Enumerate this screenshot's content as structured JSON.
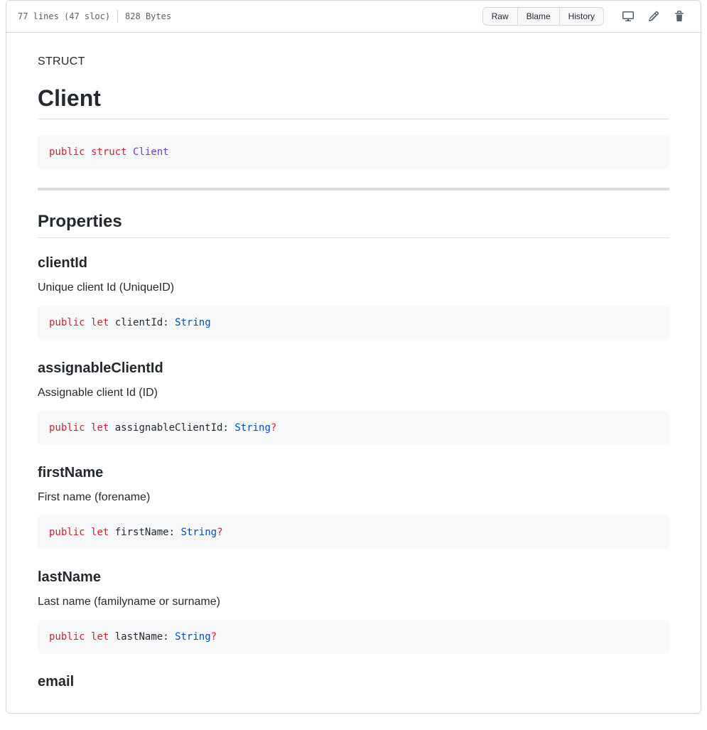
{
  "header": {
    "lines_sloc": "77 lines (47 sloc)",
    "size": "828 Bytes",
    "buttons": {
      "raw": "Raw",
      "blame": "Blame",
      "history": "History"
    }
  },
  "doc": {
    "kicker": "STRUCT",
    "title": "Client",
    "declaration": {
      "keyword1": "public",
      "keyword2": "struct",
      "typename": "Client"
    },
    "sectionTitle": "Properties",
    "properties": [
      {
        "name": "clientId",
        "desc": "Unique client Id (UniqueID)",
        "kw1": "public",
        "kw2": "let",
        "ident": "clientId",
        "colon": ":",
        "type": "String",
        "optional": ""
      },
      {
        "name": "assignableClientId",
        "desc": "Assignable client Id (ID)",
        "kw1": "public",
        "kw2": "let",
        "ident": "assignableClientId",
        "colon": ":",
        "type": "String",
        "optional": "?"
      },
      {
        "name": "firstName",
        "desc": "First name (forename)",
        "kw1": "public",
        "kw2": "let",
        "ident": "firstName",
        "colon": ":",
        "type": "String",
        "optional": "?"
      },
      {
        "name": "lastName",
        "desc": "Last name (familyname or surname)",
        "kw1": "public",
        "kw2": "let",
        "ident": "lastName",
        "colon": ":",
        "type": "String",
        "optional": "?"
      },
      {
        "name": "email",
        "desc": "",
        "kw1": "",
        "kw2": "",
        "ident": "",
        "colon": "",
        "type": "",
        "optional": ""
      }
    ]
  }
}
